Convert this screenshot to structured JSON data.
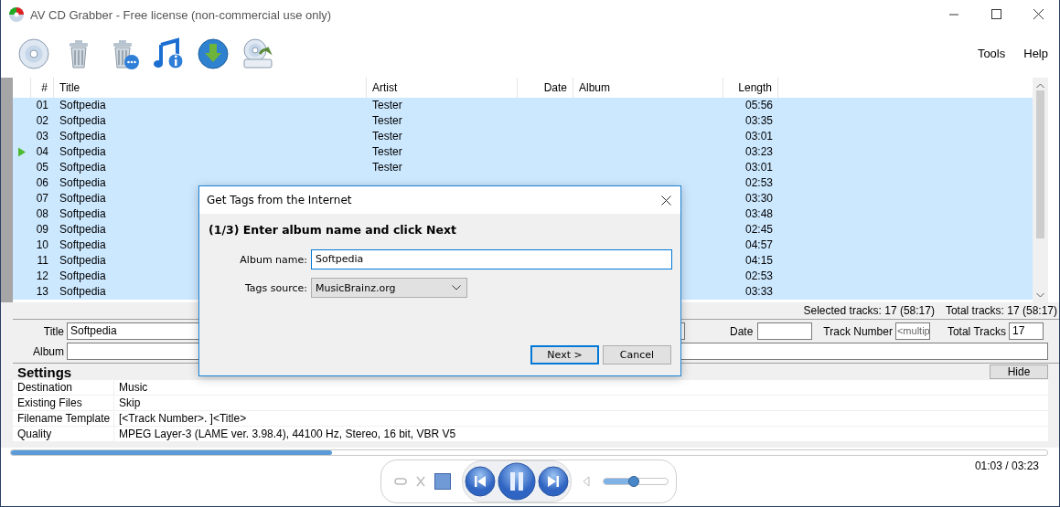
{
  "window": {
    "title": "AV CD Grabber - Free license (non-commercial use only)"
  },
  "menu": [
    {
      "label": "Tools"
    },
    {
      "label": "Help"
    }
  ],
  "tracks": {
    "columns": [
      "#",
      "Title",
      "Artist",
      "Date",
      "Album",
      "Length"
    ],
    "rows": [
      {
        "number": "01",
        "title": "Softpedia",
        "artist": "Tester",
        "length": "05:56",
        "selected": true,
        "playing": false
      },
      {
        "number": "02",
        "title": "Softpedia",
        "artist": "Tester",
        "length": "03:35",
        "selected": true,
        "playing": false
      },
      {
        "number": "03",
        "title": "Softpedia",
        "artist": "Tester",
        "length": "03:01",
        "selected": true,
        "playing": false
      },
      {
        "number": "04",
        "title": "Softpedia",
        "artist": "Tester",
        "length": "03:23",
        "selected": true,
        "playing": true
      },
      {
        "number": "05",
        "title": "Softpedia",
        "artist": "Tester",
        "length": "03:01",
        "selected": true,
        "playing": false
      },
      {
        "number": "06",
        "title": "Softpedia",
        "length": "02:53",
        "selected": true,
        "playing": false
      },
      {
        "number": "07",
        "title": "Softpedia",
        "length": "03:30",
        "selected": true,
        "playing": false
      },
      {
        "number": "08",
        "title": "Softpedia",
        "length": "03:48",
        "selected": true,
        "playing": false
      },
      {
        "number": "09",
        "title": "Softpedia",
        "length": "02:45",
        "selected": true,
        "playing": false
      },
      {
        "number": "10",
        "title": "Softpedia",
        "length": "04:57",
        "selected": true,
        "playing": false
      },
      {
        "number": "11",
        "title": "Softpedia",
        "length": "04:15",
        "selected": true,
        "playing": false
      },
      {
        "number": "12",
        "title": "Softpedia",
        "length": "02:53",
        "selected": true,
        "playing": false
      },
      {
        "number": "13",
        "title": "Softpedia",
        "length": "03:33",
        "selected": true,
        "playing": false
      }
    ]
  },
  "status": {
    "selected": "Selected tracks: 17 (58:17)",
    "total": "Total tracks: 17 (58:17)"
  },
  "tag_editor": {
    "title": {
      "label": "Title",
      "value": "Softpedia"
    },
    "date": {
      "label": "Date"
    },
    "track_number": {
      "label": "Track Number",
      "value": "<multip"
    },
    "total_tracks": {
      "label": "Total Tracks",
      "value": "17"
    },
    "album": {
      "label": "Album"
    }
  },
  "settings": {
    "title": "Settings",
    "hide_button": "Hide",
    "rows": [
      {
        "name": "Destination",
        "value": "Music"
      },
      {
        "name": "Existing Files",
        "value": "Skip"
      },
      {
        "name": "Filename Template",
        "value": "[<Track Number>. ]<Title>"
      },
      {
        "name": "Quality",
        "value": "MPEG Layer-3 (LAME ver. 3.98.4), 44100 Hz, Stereo, 16 bit, VBR V5"
      }
    ]
  },
  "progress": {
    "level": 0.31
  },
  "player": {
    "volume": {
      "level": 0.47
    },
    "time": "01:03 / 03:23"
  },
  "dialog": {
    "title": "Get Tags from the Internet",
    "step": "(1/3) Enter album name and click Next",
    "album_name": {
      "label": "Album name:",
      "value": "Softpedia"
    },
    "tags_source": {
      "label": "Tags source:",
      "value": "MusicBrainz.org"
    },
    "buttons": [
      {
        "label": "Next >",
        "default": true
      },
      {
        "label": "Cancel",
        "default": false
      }
    ]
  }
}
